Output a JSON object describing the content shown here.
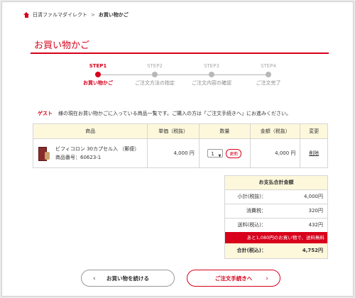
{
  "breadcrumb": {
    "home": "日清ファルマダイレクト",
    "separator": ">",
    "current": "お買い物かご"
  },
  "page_title": "お買い物かご",
  "steps": [
    {
      "label": "STEP1",
      "name": "お買い物かご",
      "active": true
    },
    {
      "label": "STEP2",
      "name": "ご注文方法の指定",
      "active": false
    },
    {
      "label": "STEP3",
      "name": "ご注文内容の確認",
      "active": false
    },
    {
      "label": "STEP4",
      "name": "ご注文完了",
      "active": false
    }
  ],
  "guest": {
    "who": "ゲスト",
    "message": "様の現在お買い物かごに入っている商品一覧です。ご購入の方は「ご注文手続きへ」にお進みください。"
  },
  "table": {
    "headers": [
      "商品",
      "単価（税抜）",
      "数量",
      "金額（税抜）",
      "変更"
    ],
    "rows": [
      {
        "name": "ビフィコロン 30カプセル入 （郵便）",
        "code": "商品番号：60623-1",
        "unit_price": "4,000 円",
        "qty": "1",
        "change_label": "更新",
        "amount": "4,000 円",
        "delete_label": "削除"
      }
    ]
  },
  "summary": {
    "head": "お支払合計金額",
    "rows": [
      {
        "label": "小計(税抜)：",
        "value": "4,000円"
      },
      {
        "label": "消費税：",
        "value": "320円"
      },
      {
        "label": "送料(税込)：",
        "value": "432円"
      }
    ],
    "note": "あと1,080円のお買い物で、送料無料",
    "total_label": "合計(税込)：",
    "total_value": "4,752円"
  },
  "buttons": {
    "back": "お買い物を続ける",
    "back_arrow": "‹",
    "next": "ご注文手続きへ",
    "next_arrow": "›"
  },
  "colors": {
    "accent": "#d8001b",
    "header_bg": "#fdf8dc"
  }
}
